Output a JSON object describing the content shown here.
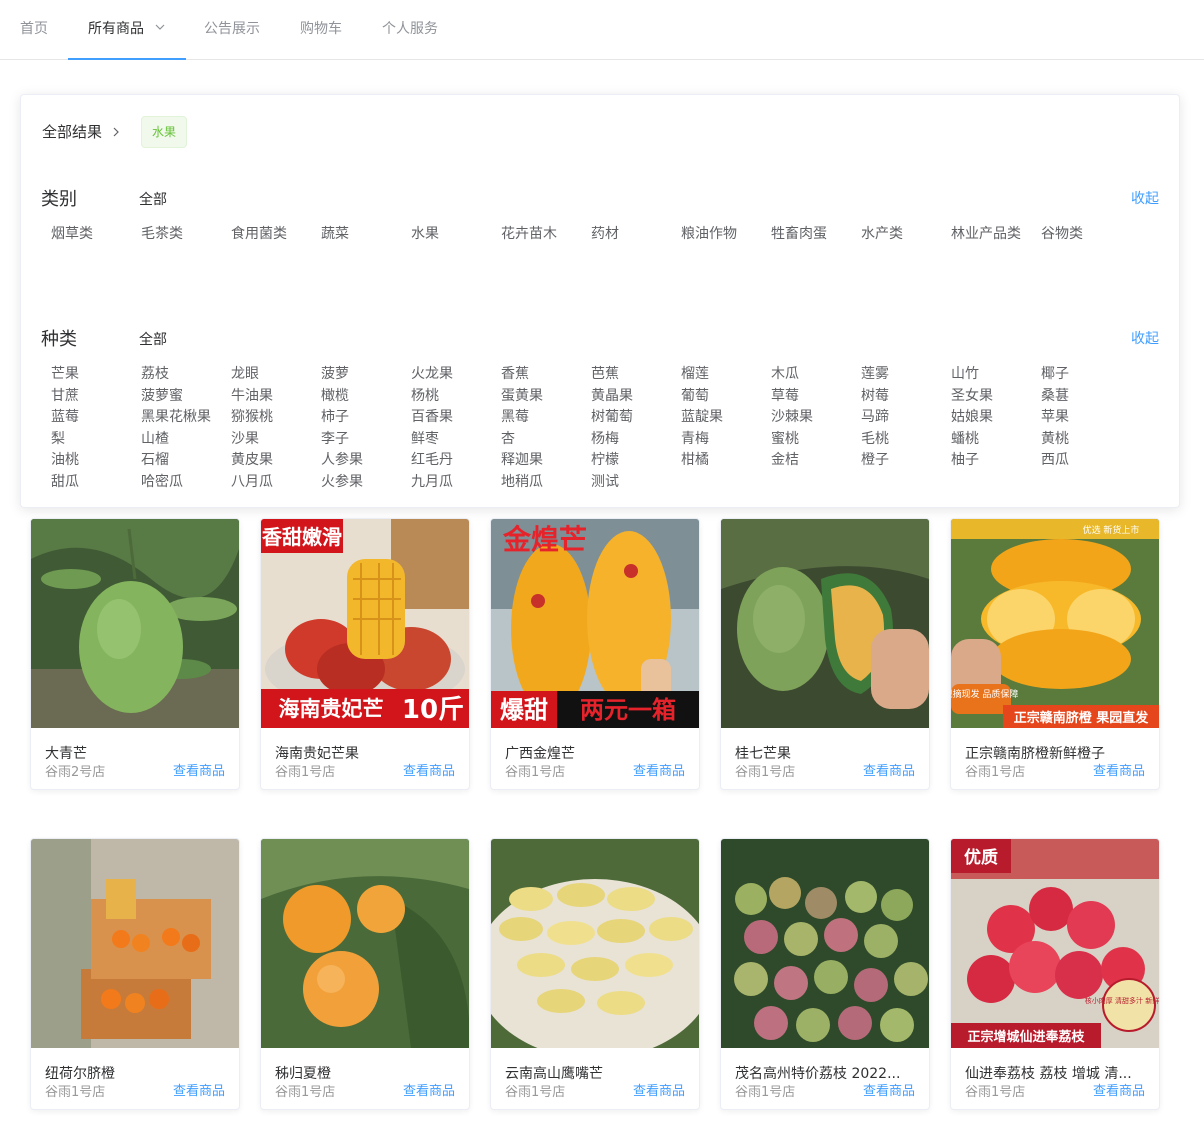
{
  "nav": {
    "items": [
      {
        "label": "首页"
      },
      {
        "label": "所有商品"
      },
      {
        "label": "公告展示"
      },
      {
        "label": "购物车"
      },
      {
        "label": "个人服务"
      }
    ]
  },
  "filter": {
    "crumb": "全部结果",
    "tag": "水果",
    "category": {
      "title": "类别",
      "all": "全部",
      "collapse": "收起",
      "items": [
        "烟草类",
        "毛茶类",
        "食用菌类",
        "蔬菜",
        "水果",
        "花卉苗木",
        "药材",
        "粮油作物",
        "牲畜肉蛋",
        "水产类",
        "林业产品类",
        "谷物类"
      ]
    },
    "kind": {
      "title": "种类",
      "all": "全部",
      "collapse": "收起",
      "items": [
        "芒果",
        "荔枝",
        "龙眼",
        "菠萝",
        "火龙果",
        "香蕉",
        "芭蕉",
        "榴莲",
        "木瓜",
        "莲雾",
        "山竹",
        "椰子",
        "甘蔗",
        "菠萝蜜",
        "牛油果",
        "橄榄",
        "杨桃",
        "蛋黄果",
        "黄晶果",
        "葡萄",
        "草莓",
        "树莓",
        "圣女果",
        "桑葚",
        "蓝莓",
        "黑果花楸果",
        "猕猴桃",
        "柿子",
        "百香果",
        "黑莓",
        "树葡萄",
        "蓝靛果",
        "沙棘果",
        "马蹄",
        "姑娘果",
        "苹果",
        "梨",
        "山楂",
        "沙果",
        "李子",
        "鲜枣",
        "杏",
        "杨梅",
        "青梅",
        "蜜桃",
        "毛桃",
        "蟠桃",
        "黄桃",
        "油桃",
        "石榴",
        "黄皮果",
        "人参果",
        "红毛丹",
        "释迦果",
        "柠檬",
        "柑橘",
        "金桔",
        "橙子",
        "柚子",
        "西瓜",
        "甜瓜",
        "哈密瓜",
        "八月瓜",
        "火参果",
        "九月瓜",
        "地稍瓜",
        "测试"
      ]
    }
  },
  "products": [
    {
      "name": "大青芒",
      "shop": "谷雨2号店",
      "action": "查看商品"
    },
    {
      "name": "海南贵妃芒果",
      "shop": "谷雨1号店",
      "action": "查看商品",
      "overlay_top": "香甜嫩滑",
      "overlay_bottom": "海南贵妃芒",
      "overlay_badge": "10斤"
    },
    {
      "name": "广西金煌芒",
      "shop": "谷雨1号店",
      "action": "查看商品",
      "overlay_top": "金煌芒",
      "overlay_bottom_left": "爆甜",
      "overlay_bottom_right": "两元一箱"
    },
    {
      "name": "桂七芒果",
      "shop": "谷雨1号店",
      "action": "查看商品"
    },
    {
      "name": "正宗赣南脐橙新鲜橙子",
      "shop": "谷雨1号店",
      "action": "查看商品",
      "overlay_banner": "正宗赣南脐橙 果园直发",
      "overlay_badge": "现摘现发 品质保障",
      "overlay_corner": "优选  新货上市"
    },
    {
      "name": "纽荷尔脐橙",
      "shop": "谷雨1号店",
      "action": "查看商品"
    },
    {
      "name": "秭归夏橙",
      "shop": "谷雨1号店",
      "action": "查看商品"
    },
    {
      "name": "云南高山鹰嘴芒",
      "shop": "谷雨1号店",
      "action": "查看商品"
    },
    {
      "name": "茂名高州特价荔枝 2022...",
      "shop": "谷雨1号店",
      "action": "查看商品"
    },
    {
      "name": "仙进奉荔枝 荔枝 增城 清...",
      "shop": "谷雨1号店",
      "action": "查看商品",
      "overlay_corner": "优质",
      "overlay_banner": "正宗增城仙进奉荔枝",
      "overlay_badge": "核小肉厚 清甜多汁 新鲜美味"
    }
  ],
  "colors": {
    "accent": "#409eff",
    "tag_green": "#67c23a"
  }
}
